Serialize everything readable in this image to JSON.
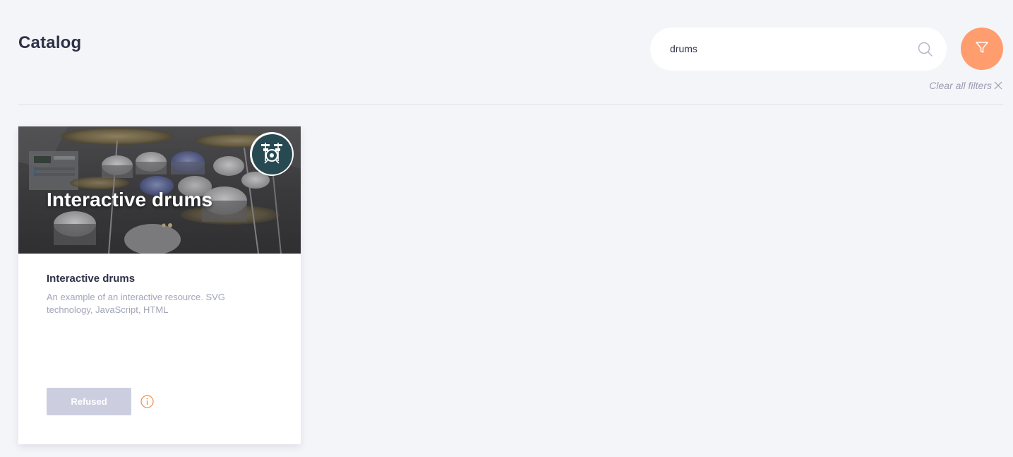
{
  "header": {
    "title": "Catalog"
  },
  "search": {
    "value": "drums",
    "icon": "search-icon"
  },
  "filter": {
    "icon": "filter-icon",
    "color": "#ff9d6e"
  },
  "clear_filters": {
    "label": "Clear all filters",
    "icon": "close-icon"
  },
  "catalog": {
    "items": [
      {
        "image_title": "Interactive drums",
        "badge_icon": "drum-kit-icon",
        "title": "Interactive drums",
        "description": "An example of an interactive resource. SVG technology, JavaScript, HTML",
        "status_label": "Refused",
        "info_icon": "info-icon"
      }
    ]
  },
  "colors": {
    "background": "#f4f5f9",
    "accent": "#ff9d6e",
    "badge": "#274a52",
    "refused_button": "#cccee0"
  }
}
